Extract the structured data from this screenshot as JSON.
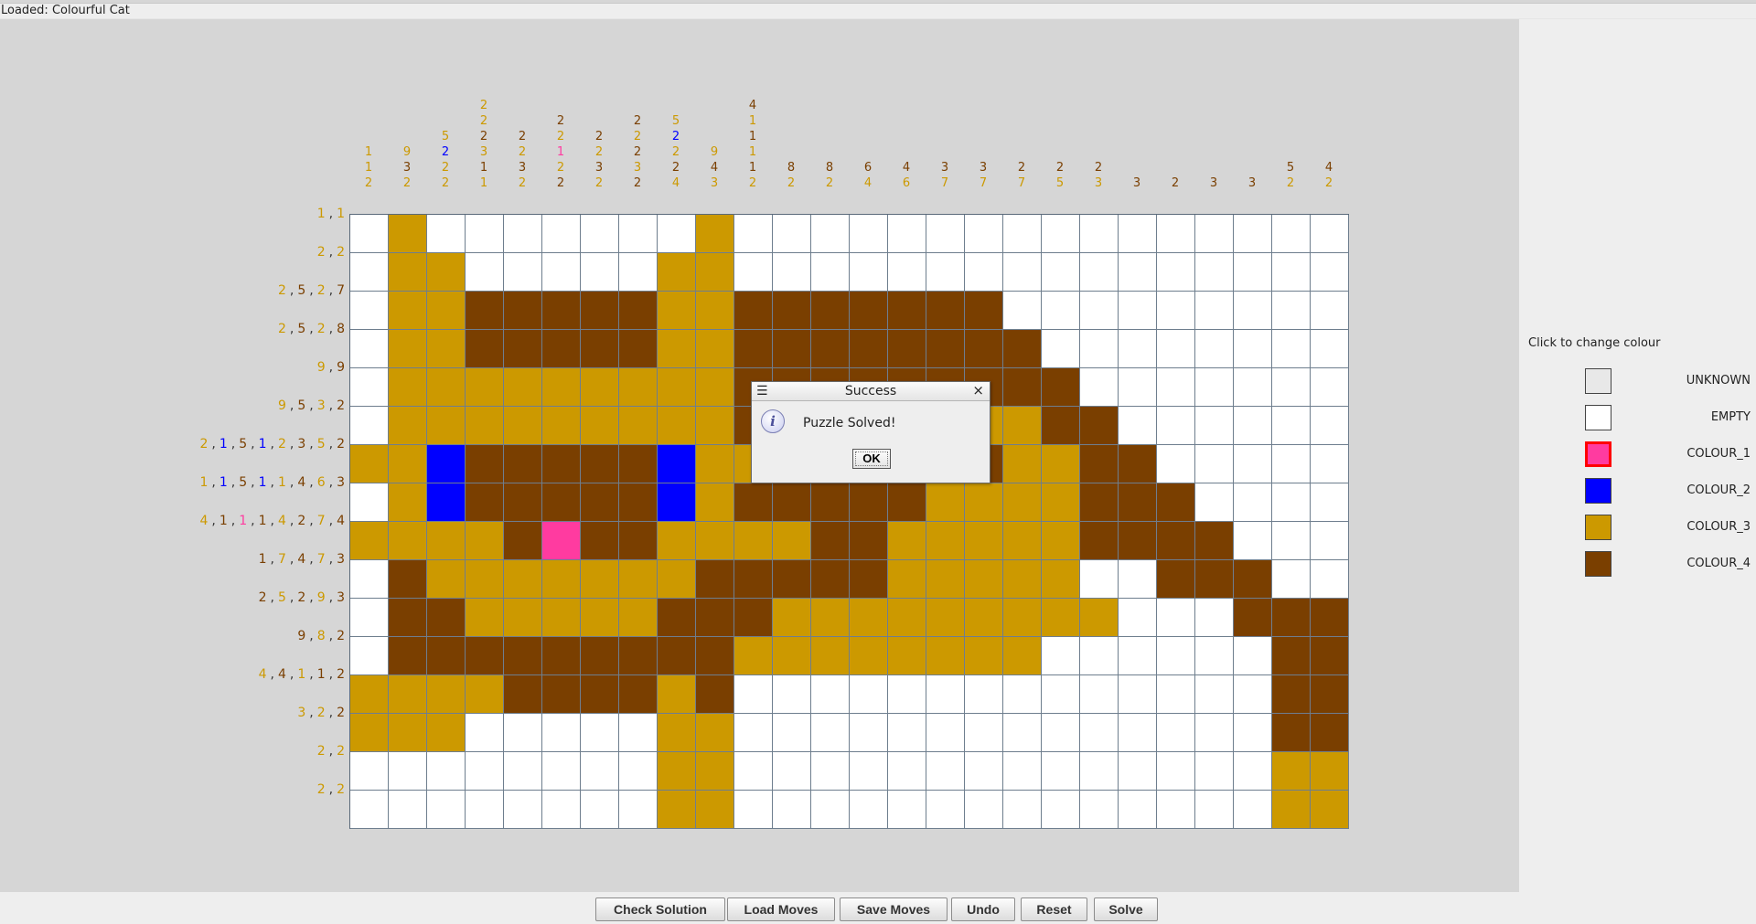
{
  "status": "Loaded: Colourful Cat",
  "colors": {
    "UNKNOWN": "#e8e8e8",
    "EMPTY": "#ffffff",
    "COLOUR_1": "#ff3ba0",
    "COLOUR_2": "#0000ff",
    "COLOUR_3": "#cc9900",
    "COLOUR_4": "#7a3f00"
  },
  "clue_colors": {
    "1": "#ff3ba0",
    "2": "#0000ff",
    "3": "#cc9900",
    "4": "#7a3f00"
  },
  "column_clues": [
    [
      [
        1,
        3
      ],
      [
        1,
        3
      ],
      [
        2,
        3
      ]
    ],
    [
      [
        9,
        3
      ],
      [
        3,
        4
      ],
      [
        2,
        3
      ]
    ],
    [
      [
        5,
        3
      ],
      [
        2,
        2
      ],
      [
        2,
        3
      ],
      [
        2,
        3
      ]
    ],
    [
      [
        2,
        3
      ],
      [
        2,
        3
      ],
      [
        2,
        4
      ],
      [
        3,
        3
      ],
      [
        1,
        4
      ],
      [
        1,
        3
      ]
    ],
    [
      [
        2,
        4
      ],
      [
        2,
        3
      ],
      [
        3,
        4
      ],
      [
        2,
        3
      ]
    ],
    [
      [
        2,
        4
      ],
      [
        2,
        3
      ],
      [
        1,
        1
      ],
      [
        2,
        3
      ],
      [
        2,
        4
      ]
    ],
    [
      [
        2,
        4
      ],
      [
        2,
        3
      ],
      [
        3,
        4
      ],
      [
        2,
        3
      ]
    ],
    [
      [
        2,
        4
      ],
      [
        2,
        3
      ],
      [
        2,
        4
      ],
      [
        3,
        3
      ],
      [
        2,
        4
      ]
    ],
    [
      [
        5,
        3
      ],
      [
        2,
        2
      ],
      [
        2,
        3
      ],
      [
        2,
        4
      ],
      [
        4,
        3
      ]
    ],
    [
      [
        9,
        3
      ],
      [
        4,
        4
      ],
      [
        3,
        3
      ]
    ],
    [
      [
        4,
        4
      ],
      [
        1,
        3
      ],
      [
        1,
        4
      ],
      [
        1,
        3
      ],
      [
        1,
        4
      ],
      [
        2,
        3
      ]
    ],
    [
      [
        8,
        4
      ],
      [
        2,
        3
      ]
    ],
    [
      [
        8,
        4
      ],
      [
        2,
        3
      ]
    ],
    [
      [
        6,
        4
      ],
      [
        4,
        3
      ]
    ],
    [
      [
        4,
        4
      ],
      [
        6,
        3
      ]
    ],
    [
      [
        3,
        4
      ],
      [
        7,
        3
      ]
    ],
    [
      [
        3,
        4
      ],
      [
        7,
        3
      ]
    ],
    [
      [
        2,
        4
      ],
      [
        7,
        3
      ]
    ],
    [
      [
        2,
        4
      ],
      [
        5,
        3
      ]
    ],
    [
      [
        2,
        4
      ],
      [
        3,
        3
      ]
    ],
    [
      [
        3,
        4
      ]
    ],
    [
      [
        2,
        4
      ]
    ],
    [
      [
        3,
        4
      ]
    ],
    [
      [
        3,
        4
      ]
    ],
    [
      [
        5,
        4
      ],
      [
        2,
        3
      ]
    ],
    [
      [
        4,
        4
      ],
      [
        2,
        3
      ]
    ]
  ],
  "row_clues": [
    [
      [
        1,
        3
      ],
      [
        1,
        3
      ]
    ],
    [
      [
        2,
        3
      ],
      [
        2,
        3
      ]
    ],
    [
      [
        2,
        3
      ],
      [
        5,
        4
      ],
      [
        2,
        3
      ],
      [
        7,
        4
      ]
    ],
    [
      [
        2,
        3
      ],
      [
        5,
        4
      ],
      [
        2,
        3
      ],
      [
        8,
        4
      ]
    ],
    [
      [
        9,
        3
      ],
      [
        9,
        4
      ]
    ],
    [
      [
        9,
        3
      ],
      [
        5,
        4
      ],
      [
        3,
        3
      ],
      [
        2,
        4
      ]
    ],
    [
      [
        2,
        3
      ],
      [
        1,
        2
      ],
      [
        5,
        4
      ],
      [
        1,
        2
      ],
      [
        2,
        3
      ],
      [
        3,
        4
      ],
      [
        5,
        3
      ],
      [
        2,
        4
      ]
    ],
    [
      [
        1,
        3
      ],
      [
        1,
        2
      ],
      [
        5,
        4
      ],
      [
        1,
        2
      ],
      [
        1,
        3
      ],
      [
        4,
        4
      ],
      [
        6,
        3
      ],
      [
        3,
        4
      ]
    ],
    [
      [
        4,
        3
      ],
      [
        1,
        4
      ],
      [
        1,
        1
      ],
      [
        1,
        4
      ],
      [
        4,
        3
      ],
      [
        2,
        4
      ],
      [
        7,
        3
      ],
      [
        4,
        4
      ]
    ],
    [
      [
        1,
        4
      ],
      [
        7,
        3
      ],
      [
        4,
        4
      ],
      [
        7,
        3
      ],
      [
        3,
        4
      ]
    ],
    [
      [
        2,
        4
      ],
      [
        5,
        3
      ],
      [
        2,
        4
      ],
      [
        9,
        3
      ],
      [
        3,
        4
      ]
    ],
    [
      [
        9,
        4
      ],
      [
        8,
        3
      ],
      [
        2,
        4
      ]
    ],
    [
      [
        4,
        3
      ],
      [
        4,
        4
      ],
      [
        1,
        3
      ],
      [
        1,
        4
      ],
      [
        2,
        4
      ]
    ],
    [
      [
        3,
        3
      ],
      [
        2,
        3
      ],
      [
        2,
        4
      ]
    ],
    [
      [
        2,
        3
      ],
      [
        2,
        3
      ]
    ],
    [
      [
        2,
        3
      ],
      [
        2,
        3
      ]
    ]
  ],
  "grid": [
    "03000000030000000000000000",
    "03300000330000000000000000",
    "03344444334444444000000000",
    "03344444334444444400000000",
    "03333333334444444440000000",
    "03333333334444443344000000",
    "33244444233444444334400000",
    "03244444234444433334440000",
    "33334144333344333334444000",
    "04333333344444333330044400",
    "04433333444333333333000444",
    "04444444443333333300000044",
    "33334444340000000000000044",
    "33300000330000000000000044",
    "00000000330000000000000033",
    "00000000330000000000000033"
  ],
  "palette": {
    "title": "Click to change colour",
    "items": [
      {
        "key": "UNKNOWN",
        "label": "UNKNOWN"
      },
      {
        "key": "EMPTY",
        "label": "EMPTY"
      },
      {
        "key": "COLOUR_1",
        "label": "COLOUR_1",
        "selected": true
      },
      {
        "key": "COLOUR_2",
        "label": "COLOUR_2"
      },
      {
        "key": "COLOUR_3",
        "label": "COLOUR_3"
      },
      {
        "key": "COLOUR_4",
        "label": "COLOUR_4"
      }
    ]
  },
  "buttons": {
    "check": "Check Solution",
    "load": "Load Moves",
    "save": "Save Moves",
    "undo": "Undo",
    "reset": "Reset",
    "solve": "Solve"
  },
  "dialog": {
    "title": "Success",
    "menu_icon": "☰",
    "close_icon": "×",
    "info_icon": "i",
    "message": "Puzzle Solved!",
    "ok_label": "OK"
  }
}
